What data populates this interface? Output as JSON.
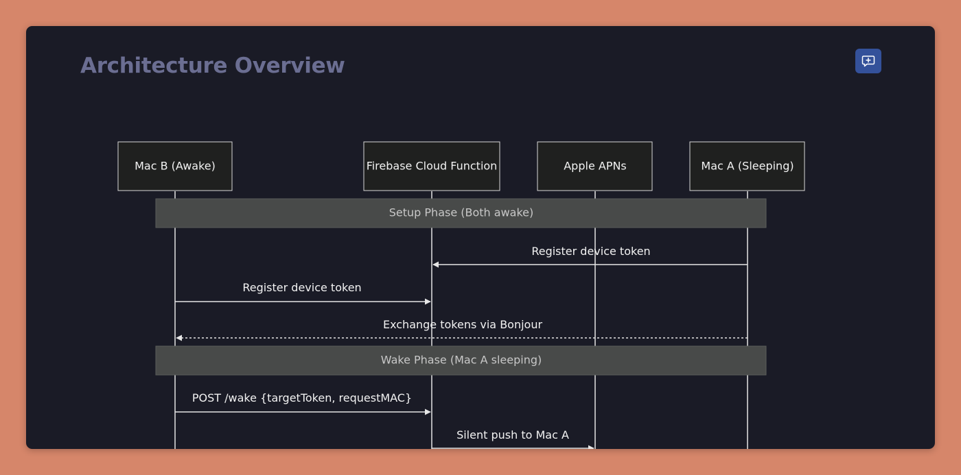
{
  "page": {
    "title": "Architecture Overview"
  },
  "toolbar": {
    "comment_icon": "comment-plus-icon"
  },
  "colors": {
    "background": "#d6866a",
    "panel": "#1a1b26",
    "title": "#6b6e92",
    "actor_fill": "#1f201f",
    "note_fill": "#484a49",
    "line": "#e6e6e6",
    "button": "#34519a"
  },
  "diagram": {
    "actors": [
      {
        "id": "macB",
        "label": "Mac B (Awake)"
      },
      {
        "id": "firebase",
        "label": "Firebase Cloud Function"
      },
      {
        "id": "apns",
        "label": "Apple APNs"
      },
      {
        "id": "macA",
        "label": "Mac A (Sleeping)"
      }
    ],
    "notes": [
      {
        "label": "Setup Phase (Both awake)"
      },
      {
        "label": "Wake Phase (Mac A sleeping)"
      }
    ],
    "messages": [
      {
        "from": "macA",
        "to": "firebase",
        "label": "Register device token",
        "style": "solid"
      },
      {
        "from": "macB",
        "to": "firebase",
        "label": "Register device token",
        "style": "solid"
      },
      {
        "from": "macA",
        "to": "macB",
        "label": "Exchange tokens via Bonjour",
        "style": "dashed"
      },
      {
        "from": "macB",
        "to": "firebase",
        "label": "POST /wake {targetToken, requestMAC}",
        "style": "solid"
      },
      {
        "from": "firebase",
        "to": "apns",
        "label": "Silent push to Mac A",
        "style": "solid"
      }
    ]
  }
}
